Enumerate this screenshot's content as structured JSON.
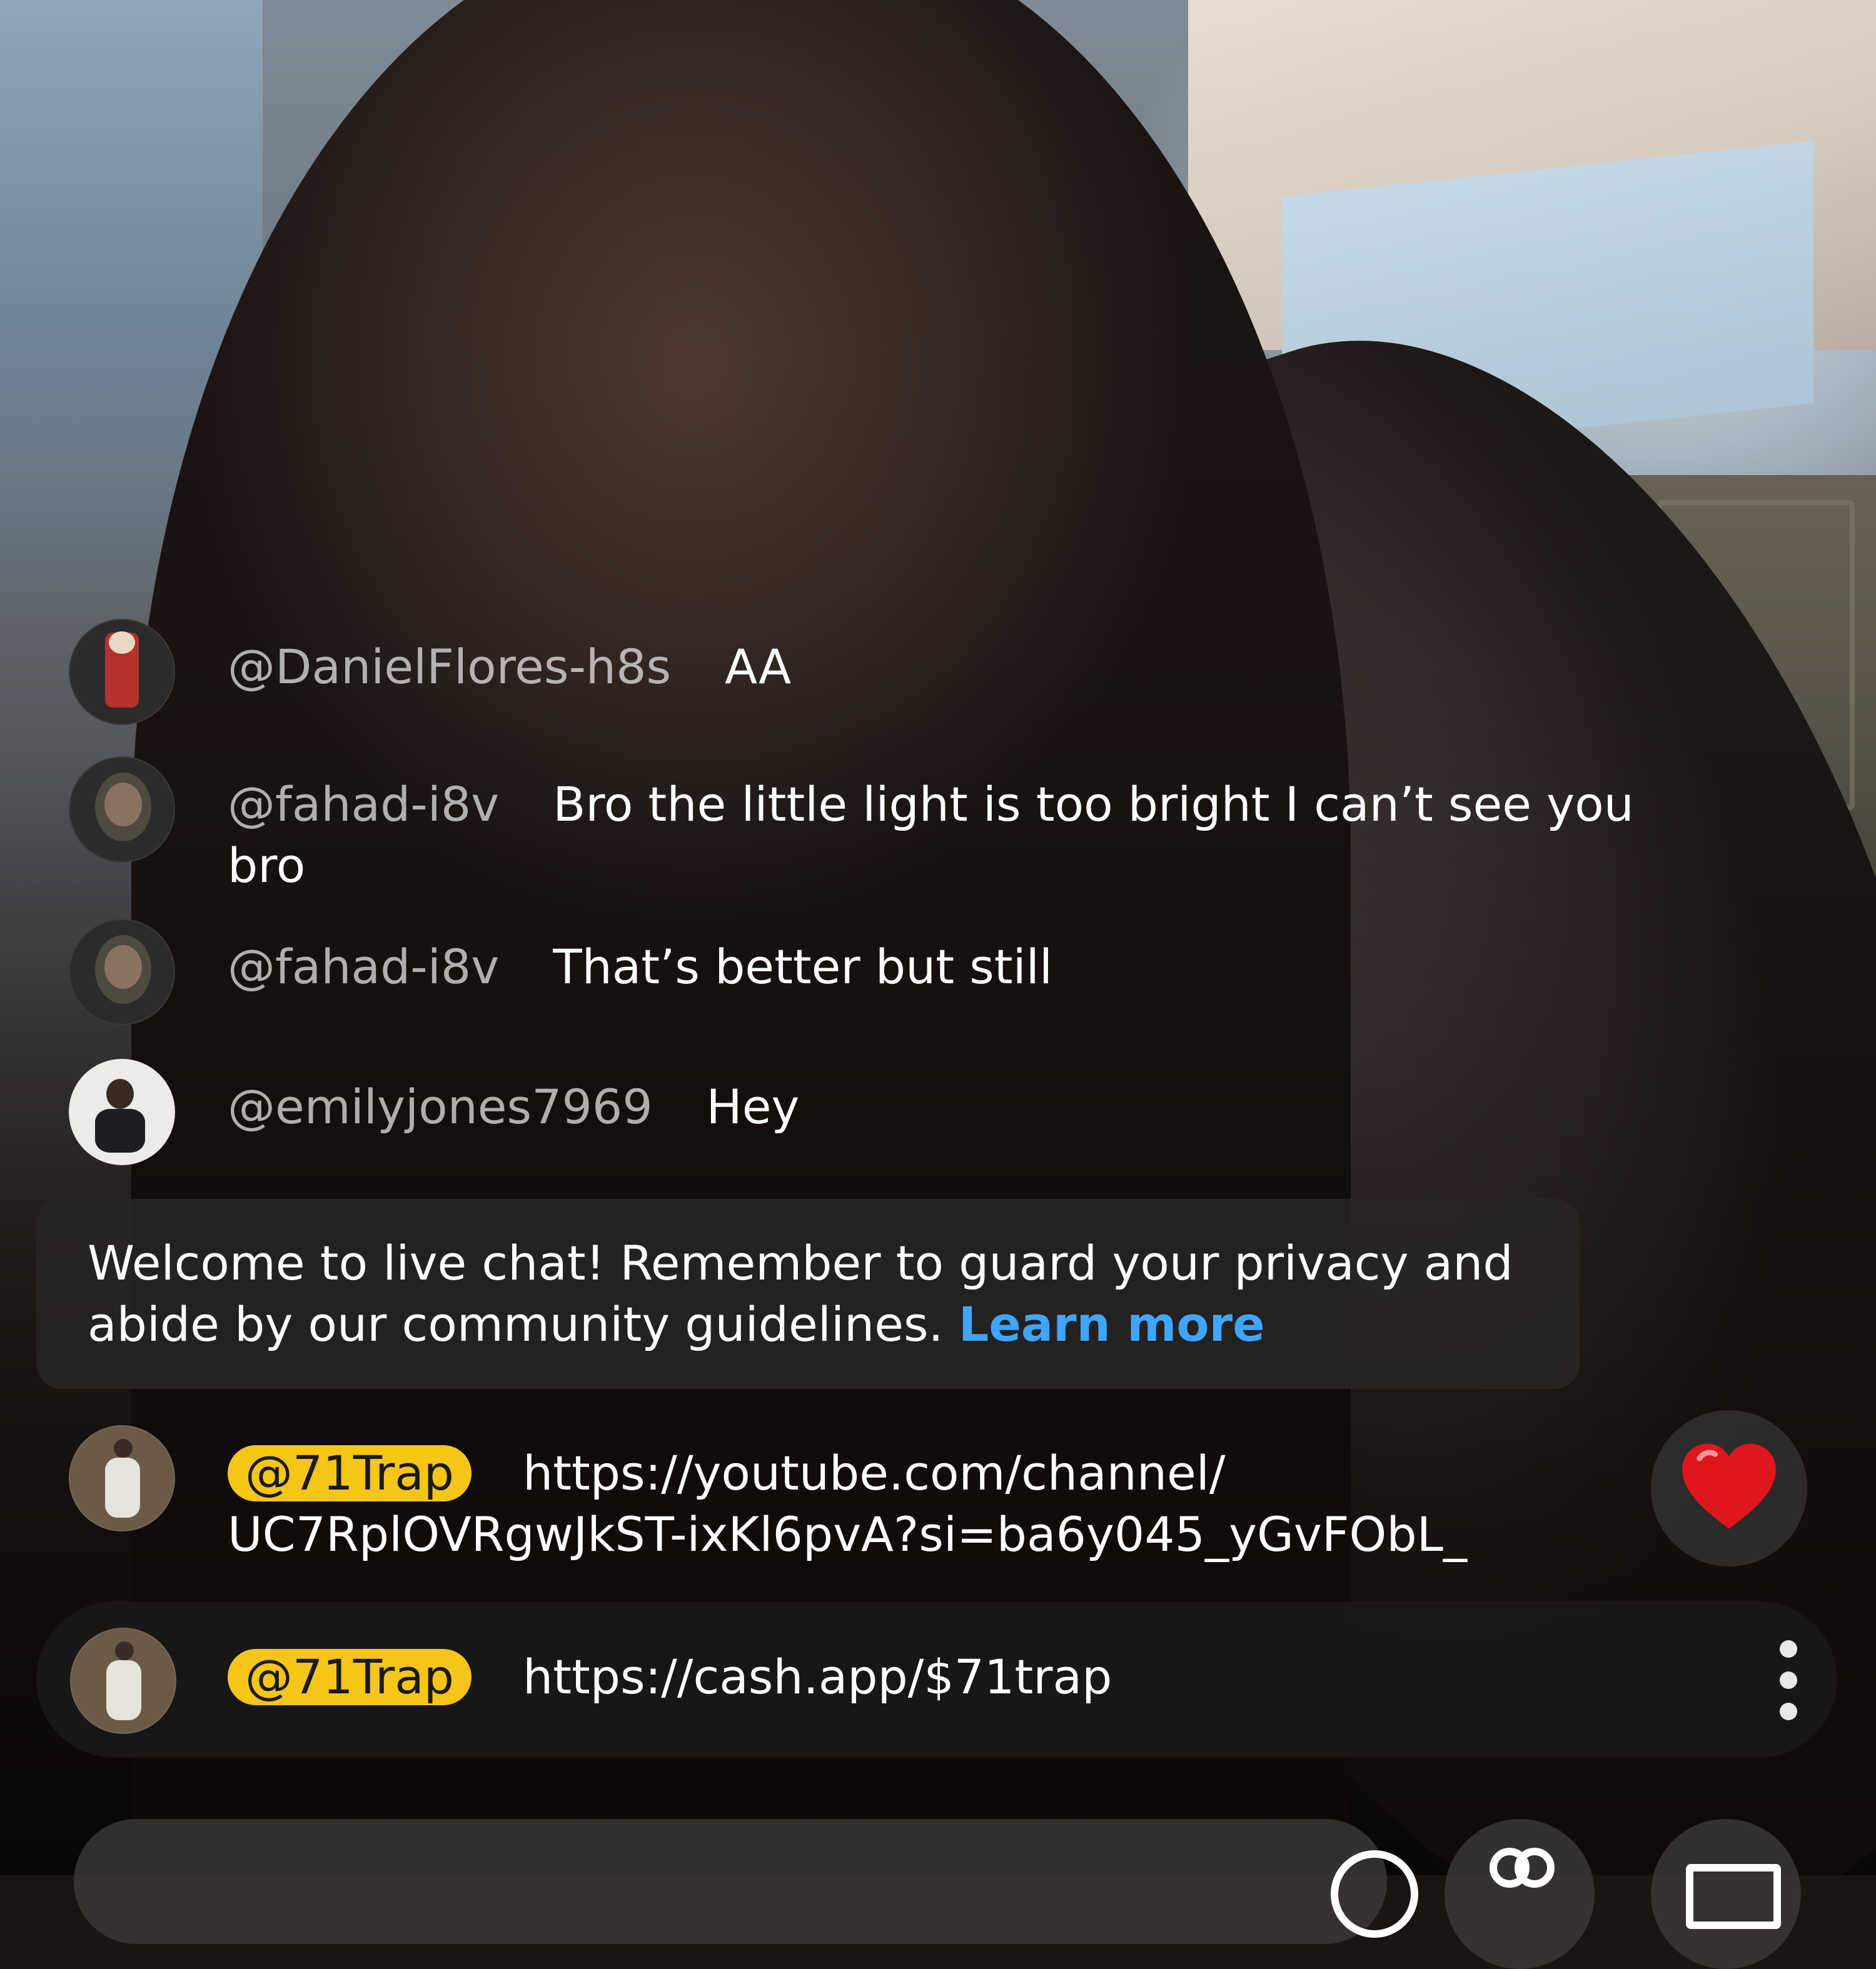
{
  "chat": {
    "messages": [
      {
        "author": "@DanielFlores-h8s",
        "text": "AA",
        "avatar_icon": "santa-figure-avatar"
      },
      {
        "author": "@fahad-i8v",
        "text": "Bro the little light is too bright I can’t see you bro",
        "avatar_icon": "man-portrait-avatar"
      },
      {
        "author": "@fahad-i8v",
        "text": "That’s better but still",
        "avatar_icon": "man-portrait-avatar"
      },
      {
        "author": "@emilyjones7969",
        "text": "Hey",
        "avatar_icon": "woman-selfie-avatar"
      },
      {
        "author": "@71Trap",
        "text": "https://youtube.com/channel/\nUC7RplOVRgwJkST-ixKl6pvA?si=ba6y045_yGvFObL_",
        "avatar_icon": "man-standing-avatar",
        "owner_badge": true
      }
    ],
    "notice": {
      "text": "Welcome to live chat! Remember to guard your privacy and abide by our community guidelines.",
      "link": "Learn more"
    },
    "pinned": {
      "author": "@71Trap",
      "text": "https://cash.app/$71trap"
    }
  },
  "colors": {
    "badge": "#f5c518",
    "link": "#3ea6ff",
    "heart": "#e0161e"
  },
  "icons": {
    "reaction": "heart-icon",
    "more": "more-vert-icon",
    "emoji": "emoji-icon",
    "gift": "gift-icon",
    "tv": "tv-icon"
  }
}
